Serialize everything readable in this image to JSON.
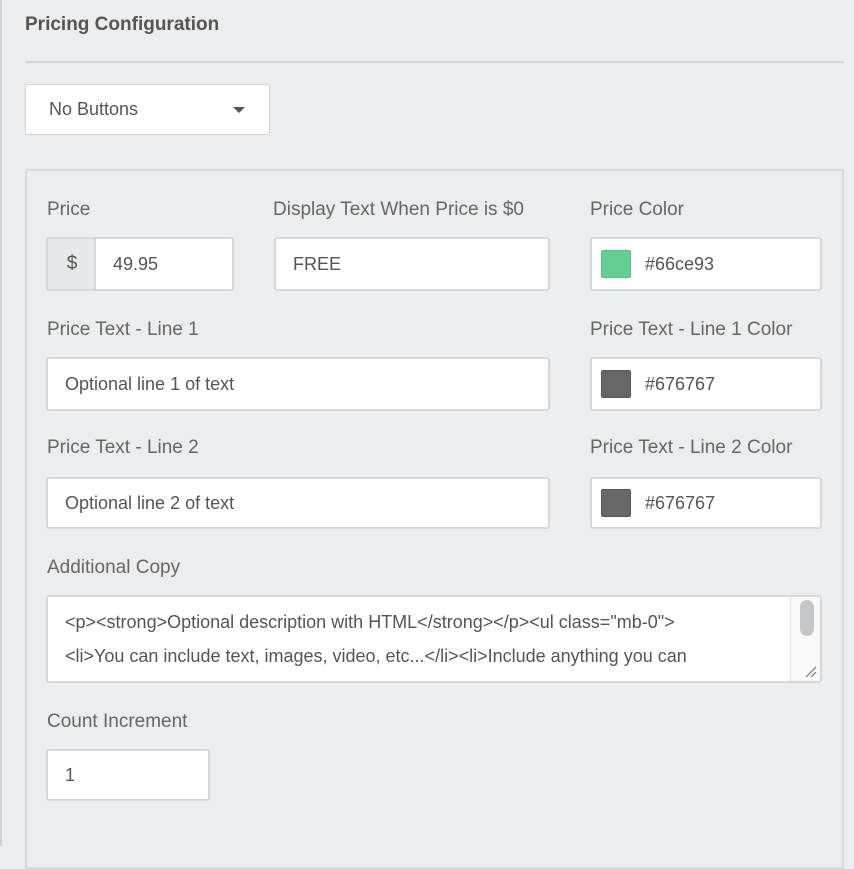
{
  "section": {
    "title": "Pricing Configuration"
  },
  "dropdown": {
    "value": "No Buttons"
  },
  "price": {
    "label": "Price",
    "currency": "$",
    "value": "49.95"
  },
  "zero_text": {
    "label": "Display Text When Price is $0",
    "value": "FREE"
  },
  "price_color": {
    "label": "Price Color",
    "value": "#66ce93",
    "swatch": "#66ce93"
  },
  "line1": {
    "label": "Price Text - Line 1",
    "value": "Optional line 1 of text"
  },
  "line1_color": {
    "label": "Price Text - Line 1 Color",
    "value": "#676767",
    "swatch": "#676767"
  },
  "line2": {
    "label": "Price Text - Line 2",
    "value": "Optional line 2 of text"
  },
  "line2_color": {
    "label": "Price Text - Line 2 Color",
    "value": "#676767",
    "swatch": "#676767"
  },
  "additional_copy": {
    "label": "Additional Copy",
    "line1": "<p><strong>Optional description with HTML</strong></p><ul class=\"mb-0\">",
    "line2": "<li>You can include text, images, video, etc...</li><li>Include anything you can"
  },
  "count_increment": {
    "label": "Count Increment",
    "value": "1"
  },
  "icons": {
    "dropdown_caret": "caret-down-icon",
    "resize": "resize-grip-icon"
  }
}
